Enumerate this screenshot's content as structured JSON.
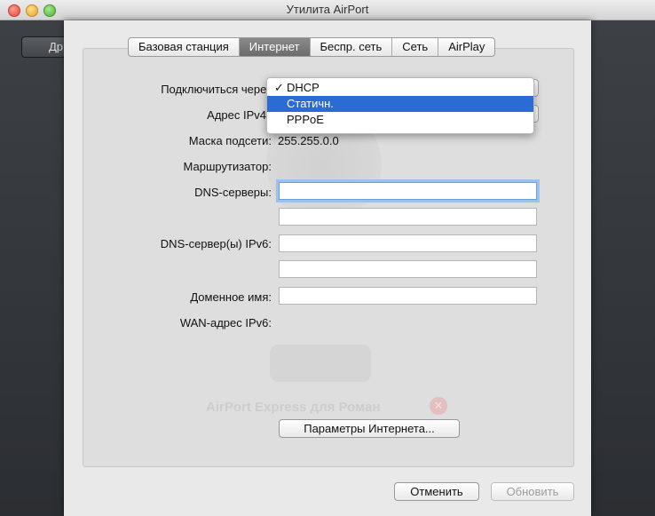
{
  "window": {
    "title": "Утилита AirPort"
  },
  "background_window": {
    "button_label": "Др"
  },
  "tabs": [
    {
      "label": "Базовая станция",
      "selected": false
    },
    {
      "label": "Интернет",
      "selected": true
    },
    {
      "label": "Беспр. сеть",
      "selected": false
    },
    {
      "label": "Сеть",
      "selected": false
    },
    {
      "label": "AirPlay",
      "selected": false
    }
  ],
  "form": {
    "connect_via": {
      "label": "Подключиться через"
    },
    "ipv4_address": {
      "label": "Адрес IPv4"
    },
    "subnet_mask": {
      "label": "Маска подсети:",
      "value": "255.255.0.0"
    },
    "router": {
      "label": "Маршрутизатор:",
      "value": ""
    },
    "dns_servers": {
      "label": "DNS-серверы:",
      "fields": [
        "",
        ""
      ]
    },
    "dns_ipv6": {
      "label": "DNS-сервер(ы) IPv6:",
      "fields": [
        "",
        ""
      ]
    },
    "domain_name": {
      "label": "Доменное имя:",
      "value": ""
    },
    "wan_ipv6": {
      "label": "WAN-адрес IPv6:",
      "value": ""
    }
  },
  "connect_menu": {
    "options": [
      {
        "label": "DHCP",
        "checkmark": "✓",
        "checked": true,
        "highlighted": false
      },
      {
        "label": "Статичн.",
        "checkmark": "",
        "checked": false,
        "highlighted": true
      },
      {
        "label": "PPPoE",
        "checkmark": "",
        "checked": false,
        "highlighted": false
      }
    ]
  },
  "watermark": {
    "device_name": "AirPort Express для Роман",
    "badge": "✕"
  },
  "buttons": {
    "internet_settings": "Параметры Интернета...",
    "cancel": "Отменить",
    "update": "Обновить"
  }
}
